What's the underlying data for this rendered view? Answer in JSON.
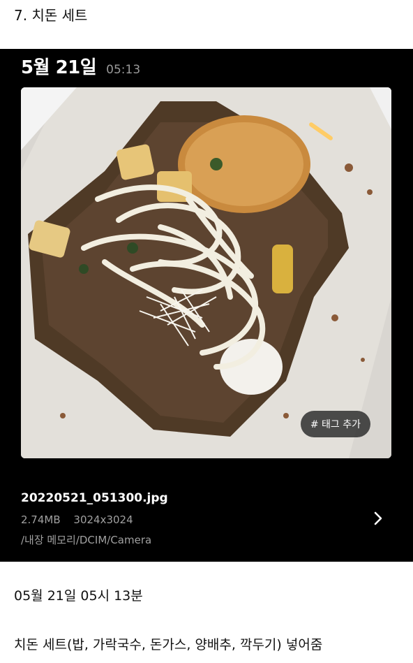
{
  "section": {
    "title": "7. 치돈 세트"
  },
  "photo_card": {
    "date": "5월 21일",
    "time": "05:13",
    "tag_button_label": "# 태그 추가",
    "file_name": "20220521_051300.jpg",
    "file_size": "2.74MB",
    "resolution": "3024x3024",
    "path": "/내장 메모리/DCIM/Camera",
    "background_color": "#000000",
    "image_icon": "food-photo"
  },
  "note": {
    "timestamp": "05월 21일 05시 13분",
    "description": "치돈 세트(밥, 가락국수, 돈가스, 양배추, 깍두기) 넣어줌"
  }
}
